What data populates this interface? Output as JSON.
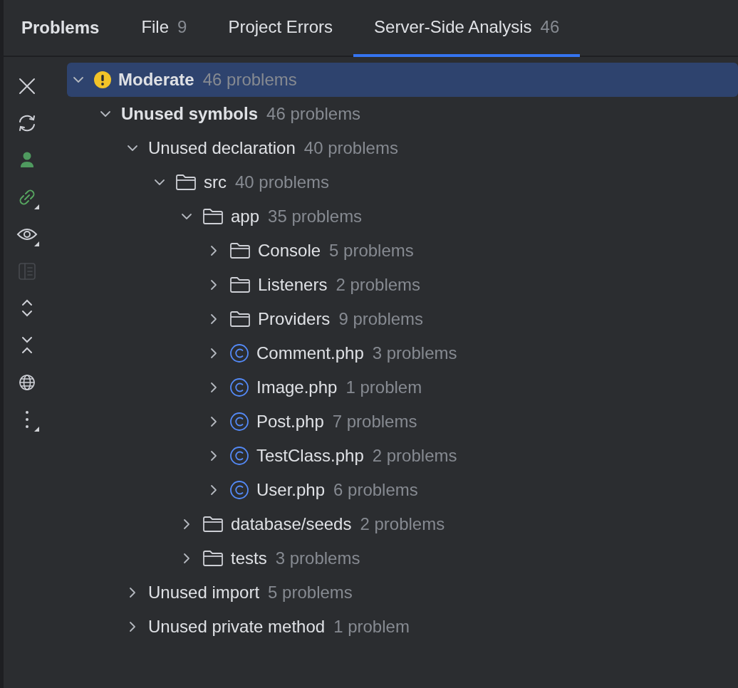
{
  "title": "Problems",
  "tabs": [
    {
      "label": "File",
      "count": "9",
      "selected": false
    },
    {
      "label": "Project Errors",
      "selected": false
    },
    {
      "label": "Server-Side Analysis",
      "count": "46",
      "selected": true
    }
  ],
  "toolbar": [
    {
      "kind": "close",
      "disabled": false,
      "dropdown": false
    },
    {
      "kind": "refresh",
      "disabled": false,
      "dropdown": false
    },
    {
      "kind": "person",
      "disabled": false,
      "dropdown": false
    },
    {
      "kind": "link",
      "disabled": false,
      "dropdown": true
    },
    {
      "kind": "eye",
      "disabled": false,
      "dropdown": true
    },
    {
      "kind": "preview",
      "disabled": true,
      "dropdown": false
    },
    {
      "kind": "expand",
      "disabled": false,
      "dropdown": false
    },
    {
      "kind": "collapse",
      "disabled": false,
      "dropdown": false
    },
    {
      "kind": "globe",
      "disabled": false,
      "dropdown": false
    },
    {
      "kind": "more",
      "disabled": false,
      "dropdown": true
    }
  ],
  "tree": [
    {
      "kind": "severity",
      "label": "Moderate",
      "count": "46 problems",
      "expanded": true,
      "selected": true,
      "children": [
        {
          "kind": "group",
          "label": "Unused symbols",
          "count": "46 problems",
          "expanded": true,
          "selected": false,
          "children": [
            {
              "kind": "inspection",
              "label": "Unused declaration",
              "count": "40 problems",
              "expanded": true,
              "selected": false,
              "children": [
                {
                  "kind": "folder",
                  "label": "src",
                  "count": "40 problems",
                  "expanded": true,
                  "selected": false,
                  "children": [
                    {
                      "kind": "folder",
                      "label": "app",
                      "count": "35 problems",
                      "expanded": true,
                      "selected": false,
                      "children": [
                        {
                          "kind": "folder",
                          "label": "Console",
                          "count": "5 problems",
                          "expanded": false,
                          "selected": false
                        },
                        {
                          "kind": "folder",
                          "label": "Listeners",
                          "count": "2 problems",
                          "expanded": false,
                          "selected": false
                        },
                        {
                          "kind": "folder",
                          "label": "Providers",
                          "count": "9 problems",
                          "expanded": false,
                          "selected": false
                        },
                        {
                          "kind": "class",
                          "label": "Comment.php",
                          "count": "3 problems",
                          "expanded": false,
                          "selected": false
                        },
                        {
                          "kind": "class",
                          "label": "Image.php",
                          "count": "1 problem",
                          "expanded": false,
                          "selected": false
                        },
                        {
                          "kind": "class",
                          "label": "Post.php",
                          "count": "7 problems",
                          "expanded": false,
                          "selected": false
                        },
                        {
                          "kind": "class",
                          "label": "TestClass.php",
                          "count": "2 problems",
                          "expanded": false,
                          "selected": false
                        },
                        {
                          "kind": "class",
                          "label": "User.php",
                          "count": "6 problems",
                          "expanded": false,
                          "selected": false
                        }
                      ]
                    },
                    {
                      "kind": "folder",
                      "label": "database/seeds",
                      "count": "2 problems",
                      "expanded": false,
                      "selected": false
                    },
                    {
                      "kind": "folder",
                      "label": "tests",
                      "count": "3 problems",
                      "expanded": false,
                      "selected": false
                    }
                  ]
                }
              ]
            },
            {
              "kind": "inspection",
              "label": "Unused import",
              "count": "5 problems",
              "expanded": false,
              "selected": false
            },
            {
              "kind": "inspection",
              "label": "Unused private method",
              "count": "1 problem",
              "expanded": false,
              "selected": false
            }
          ]
        }
      ]
    }
  ]
}
